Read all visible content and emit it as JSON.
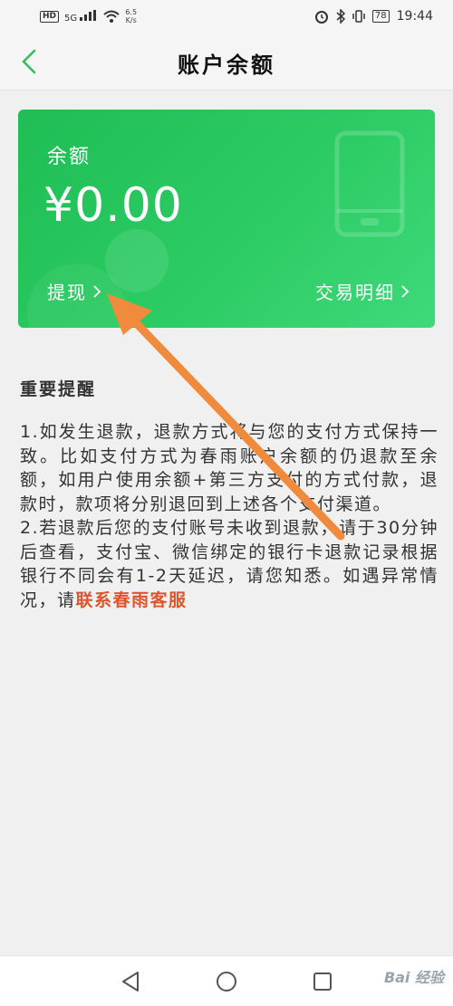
{
  "status_bar": {
    "hd": "HD",
    "signal": "5G",
    "net_speed": "6.5",
    "net_unit": "K/s",
    "battery": "78",
    "time": "19:44"
  },
  "header": {
    "title": "账户余额"
  },
  "card": {
    "label": "余额",
    "amount": "¥0.00",
    "withdraw": "提现",
    "details": "交易明细"
  },
  "notice": {
    "title": "重要提醒",
    "p1": "1.如发生退款，退款方式将与您的支付方式保持一致。比如支付方式为春雨账户余额的仍退款至余额，如用户使用余额+第三方支付的方式付款，退款时，款项将分别退回到上述各个支付渠道。",
    "p2": "2.若退款后您的支付账号未收到退款，请于30分钟后查看，支付宝、微信绑定的银行卡退款记录根据银行不同会有1-2天延迟，请您知悉。如遇异常情况，请",
    "contact": "联系春雨客服"
  },
  "watermark": "Bai 经验",
  "colors": {
    "card_green": "#2ccb63",
    "back_green": "#2fbf5a",
    "link_red": "#e0542c",
    "arrow_orange": "#f08a3c"
  }
}
